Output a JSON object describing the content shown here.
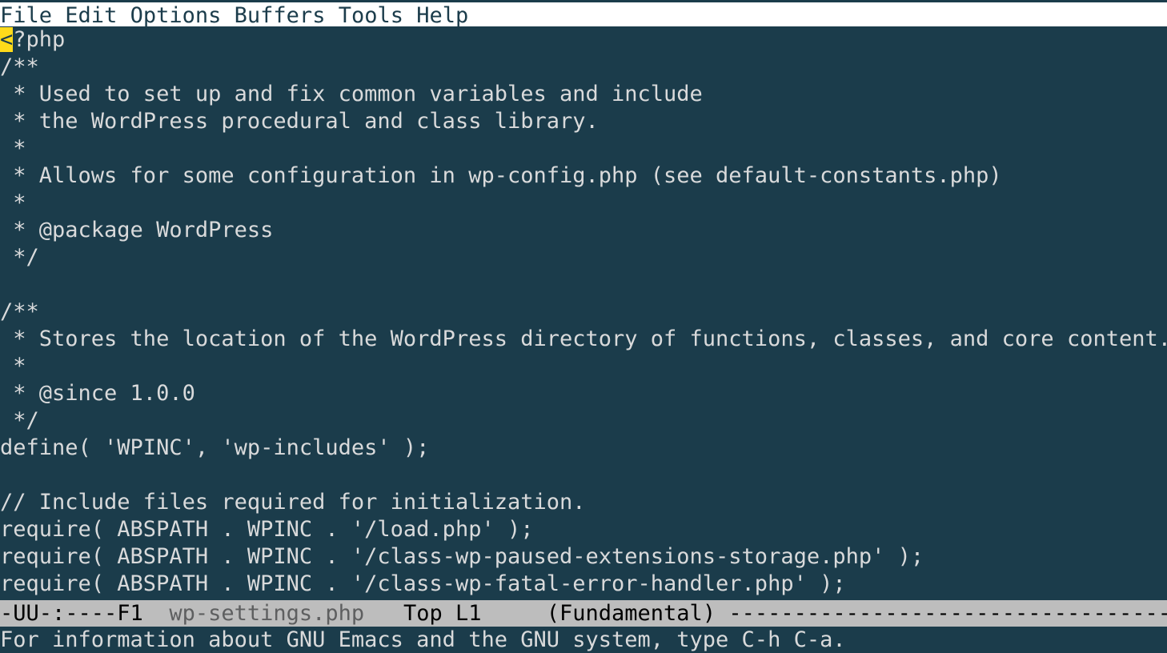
{
  "menubar": {
    "items": [
      "File",
      "Edit",
      "Options",
      "Buffers",
      "Tools",
      "Help"
    ]
  },
  "buffer": {
    "cursor_char": "<",
    "rest_of_first_line": "?php",
    "lines": [
      "/**",
      " * Used to set up and fix common variables and include",
      " * the WordPress procedural and class library.",
      " *",
      " * Allows for some configuration in wp-config.php (see default-constants.php)",
      " *",
      " * @package WordPress",
      " */",
      "",
      "/**",
      " * Stores the location of the WordPress directory of functions, classes, and core content.",
      " *",
      " * @since 1.0.0",
      " */",
      "define( 'WPINC', 'wp-includes' );",
      "",
      "// Include files required for initialization.",
      "require( ABSPATH . WPINC . '/load.php' );",
      "require( ABSPATH . WPINC . '/class-wp-paused-extensions-storage.php' );",
      "require( ABSPATH . WPINC . '/class-wp-fatal-error-handler.php' );"
    ]
  },
  "modeline": {
    "left": "-UU-:----F1  ",
    "buffer_name": "wp-settings.php",
    "position": "   Top L1     ",
    "mode": "(Fundamental)",
    "trail": " ----------------------------------------"
  },
  "minibuffer": {
    "text": "For information about GNU Emacs and the GNU system, type C-h C-a."
  }
}
